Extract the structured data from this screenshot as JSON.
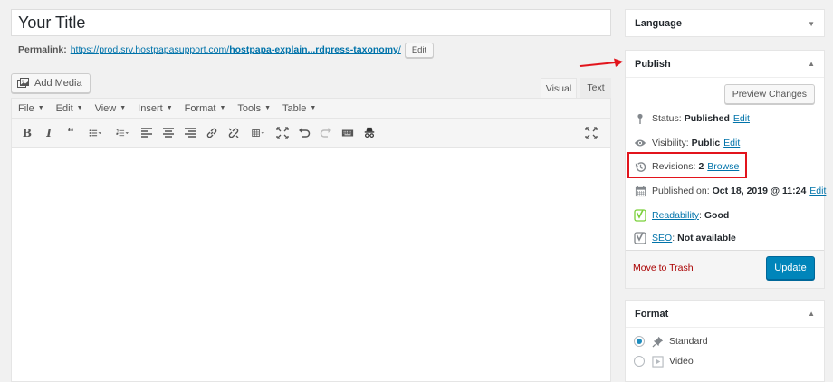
{
  "title": "Your Title",
  "permalink": {
    "label": "Permalink:",
    "url_prefix": "https://prod.srv.hostpapasupport.com/",
    "url_bold": "hostpapa-explain...rdpress-taxonomy",
    "url_suffix": "/",
    "edit_label": "Edit"
  },
  "add_media_label": "Add Media",
  "tabs": {
    "visual": "Visual",
    "text": "Text"
  },
  "menu": [
    "File",
    "Edit",
    "View",
    "Insert",
    "Format",
    "Tools",
    "Table"
  ],
  "language": {
    "title": "Language"
  },
  "publish": {
    "title": "Publish",
    "preview_label": "Preview Changes",
    "status_label": "Status:",
    "status_value": "Published",
    "status_edit": "Edit",
    "visibility_label": "Visibility:",
    "visibility_value": "Public",
    "visibility_edit": "Edit",
    "revisions_label": "Revisions:",
    "revisions_value": "2",
    "revisions_browse": "Browse",
    "published_label": "Published on:",
    "published_value": "Oct 18, 2019 @ 11:24",
    "published_edit": "Edit",
    "readability_link": "Readability",
    "readability_value": "Good",
    "seo_link": "SEO",
    "seo_value": "Not available",
    "trash_label": "Move to Trash",
    "update_label": "Update"
  },
  "format": {
    "title": "Format",
    "options": [
      "Standard",
      "Video"
    ],
    "selected": "Standard"
  },
  "colors": {
    "accent": "#0085ba",
    "link": "#0073aa",
    "highlight": "#e2141c",
    "yoast_green": "#7ad03a"
  }
}
